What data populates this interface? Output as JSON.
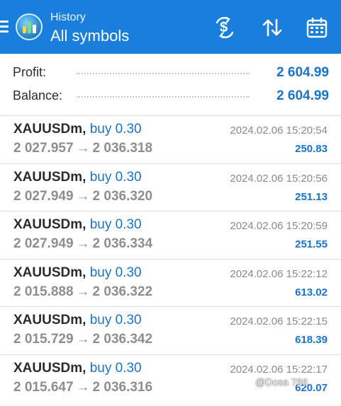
{
  "header": {
    "subtitle": "History",
    "title": "All symbols",
    "icons": [
      "menu-icon",
      "app-logo",
      "currency-exchange-icon",
      "sort-icon",
      "calendar-icon"
    ],
    "background": "#1a7fdc"
  },
  "summary": {
    "profit_label": "Profit:",
    "profit_value": "2 604.99",
    "balance_label": "Balance:",
    "balance_value": "2 604.99"
  },
  "trades": [
    {
      "symbol": "XAUUSDm,",
      "side": "buy 0.30",
      "open": "2 027.957",
      "close": "2 036.318",
      "time": "2024.02.06 15:20:54",
      "profit": "250.83"
    },
    {
      "symbol": "XAUUSDm,",
      "side": "buy 0.30",
      "open": "2 027.949",
      "close": "2 036.320",
      "time": "2024.02.06 15:20:56",
      "profit": "251.13"
    },
    {
      "symbol": "XAUUSDm,",
      "side": "buy 0.30",
      "open": "2 027.949",
      "close": "2 036.334",
      "time": "2024.02.06 15:20:59",
      "profit": "251.55"
    },
    {
      "symbol": "XAUUSDm,",
      "side": "buy 0.30",
      "open": "2 015.888",
      "close": "2 036.322",
      "time": "2024.02.06 15:22:12",
      "profit": "613.02"
    },
    {
      "symbol": "XAUUSDm,",
      "side": "buy 0.30",
      "open": "2 015.729",
      "close": "2 036.342",
      "time": "2024.02.06 15:22:15",
      "profit": "618.39"
    },
    {
      "symbol": "XAUUSDm,",
      "side": "buy 0.30",
      "open": "2 015.647",
      "close": "2 036.316",
      "time": "2024.02.06 15:22:17",
      "profit": "620.07"
    }
  ],
  "arrow": "→",
  "watermark": "@Dosa 786",
  "colors": {
    "accent": "#1a73c8",
    "muted": "#8e8e8e"
  }
}
